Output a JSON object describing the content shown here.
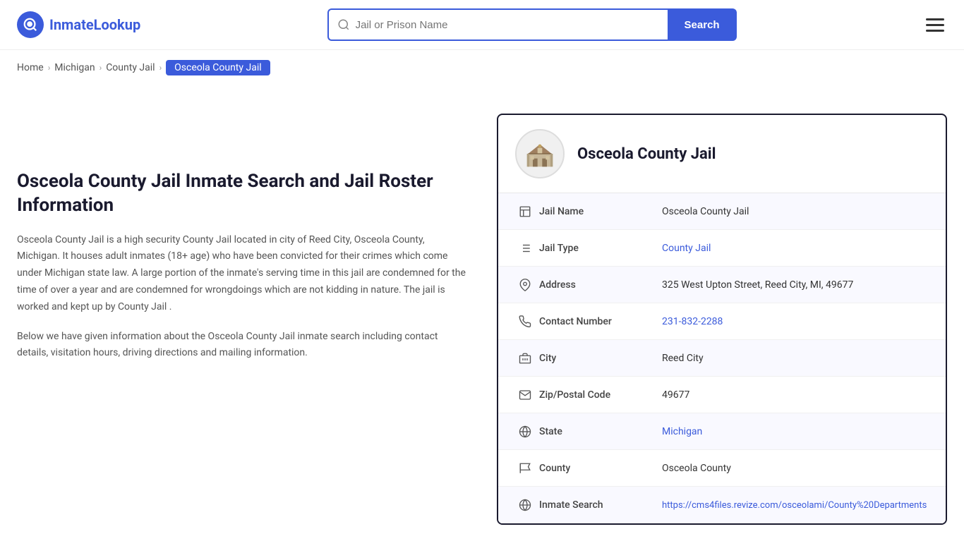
{
  "header": {
    "logo_text_1": "Inmate",
    "logo_text_2": "Lookup",
    "search_placeholder": "Jail or Prison Name",
    "search_button_label": "Search",
    "menu_icon": "hamburger-menu"
  },
  "breadcrumb": {
    "items": [
      {
        "label": "Home",
        "href": "#",
        "active": false
      },
      {
        "label": "Michigan",
        "href": "#",
        "active": false
      },
      {
        "label": "County Jail",
        "href": "#",
        "active": false
      },
      {
        "label": "Osceola County Jail",
        "href": "#",
        "active": true
      }
    ]
  },
  "left": {
    "title": "Osceola County Jail Inmate Search and Jail Roster Information",
    "description1": "Osceola County Jail is a high security County Jail located in city of Reed City, Osceola County, Michigan. It houses adult inmates (18+ age) who have been convicted for their crimes which come under Michigan state law. A large portion of the inmate's serving time in this jail are condemned for the time of over a year and are condemned for wrongdoings which are not kidding in nature. The jail is worked and kept up by County Jail .",
    "description2": "Below we have given information about the Osceola County Jail inmate search including contact details, visitation hours, driving directions and mailing information."
  },
  "card": {
    "title": "Osceola County Jail",
    "rows": [
      {
        "icon": "building-icon",
        "label": "Jail Name",
        "value": "Osceola County Jail",
        "link": false
      },
      {
        "icon": "list-icon",
        "label": "Jail Type",
        "value": "County Jail",
        "link": true,
        "href": "#"
      },
      {
        "icon": "location-icon",
        "label": "Address",
        "value": "325 West Upton Street, Reed City, MI, 49677",
        "link": false
      },
      {
        "icon": "phone-icon",
        "label": "Contact Number",
        "value": "231-832-2288",
        "link": true,
        "href": "tel:231-832-2288"
      },
      {
        "icon": "city-icon",
        "label": "City",
        "value": "Reed City",
        "link": false
      },
      {
        "icon": "mail-icon",
        "label": "Zip/Postal Code",
        "value": "49677",
        "link": false
      },
      {
        "icon": "globe-icon",
        "label": "State",
        "value": "Michigan",
        "link": true,
        "href": "#"
      },
      {
        "icon": "flag-icon",
        "label": "County",
        "value": "Osceola County",
        "link": false
      },
      {
        "icon": "search-globe-icon",
        "label": "Inmate Search",
        "value": "https://cms4files.revize.com/osceolami/County%20Departments",
        "link": true,
        "href": "#"
      }
    ]
  }
}
